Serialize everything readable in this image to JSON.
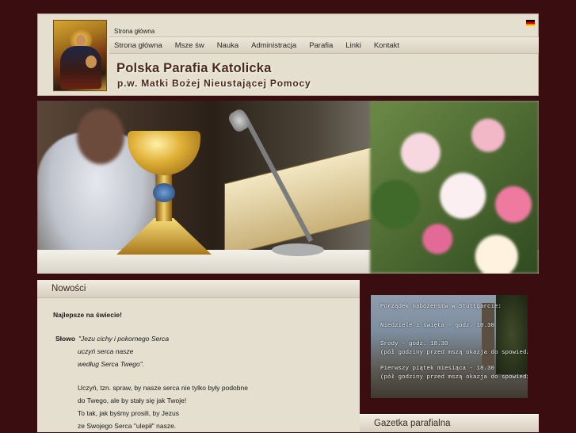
{
  "header": {
    "breadcrumb": "Strona główna",
    "language_flag": "german-flag-icon",
    "title": "Polska Parafia Katolicka",
    "subtitle": "p.w. Matki Bożej Nieustającej Pomocy"
  },
  "nav": {
    "items": [
      "Strona główna",
      "Msze św",
      "Nauka",
      "Administracja",
      "Parafia",
      "Linki",
      "Kontakt"
    ]
  },
  "content": {
    "heading": "Nowości",
    "lead": "Najlepsze na świecie!",
    "slowo_label": "Słowo",
    "quote": [
      "\"Jezu cichy i pokornego Serca",
      "uczyń serca nasze",
      "według Serca Twego\"."
    ],
    "paragraph": [
      "Uczyń, tzn. spraw, by nasze serca nie tylko były podobne",
      "do Twego, ale by stały się jak Twoje!",
      "To tak, jak byśmy prosili, by Jezus",
      "ze Swojego Serca \"ulepił\" nasze."
    ]
  },
  "sidebar": {
    "schedule": [
      "Porządek nabożeństw w Stuttgarcie:",
      "Niedziele i święta - godz. 10.30",
      "Środy - godz. 18.30",
      "(pół godziny przed mszą okazja do spowiedzi)",
      "Pierwszy piątek miesiąca - 18.30",
      "(pół godziny przed mszą okazja do spowiedzi)"
    ],
    "gazetka_heading": "Gazetka parafialna"
  },
  "colors": {
    "background": "#3a0d10",
    "panel": "#e5dfd0",
    "title_text": "#4a2a18"
  }
}
